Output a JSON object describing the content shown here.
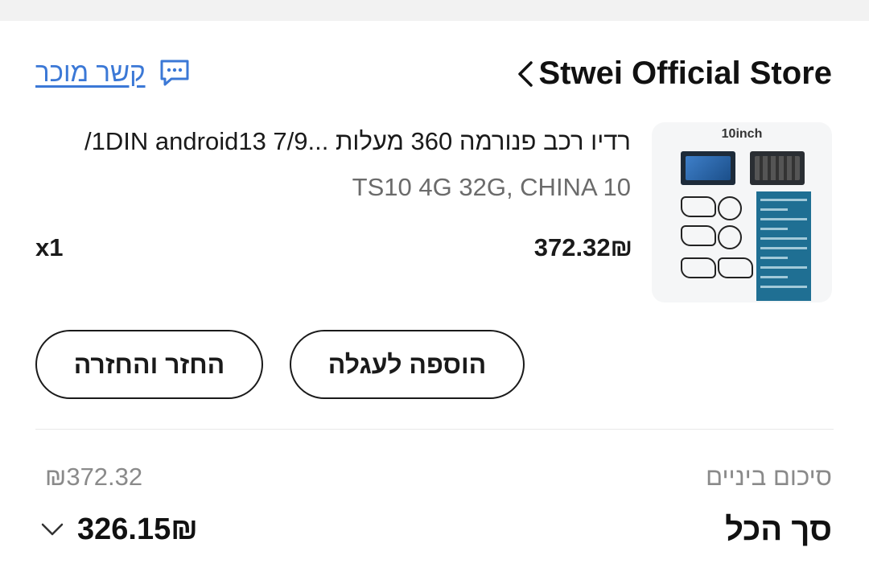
{
  "store": {
    "name": "Stwei Official Store",
    "contact_label": "קשר מוכר"
  },
  "product": {
    "thumbnail_caption": "10inch",
    "title": "רדיו רכב פנורמה 360 מעלות ...1DIN android13 7/9/",
    "variant": "TS10 4G 32G, CHINA 10",
    "price": "372.32₪",
    "quantity": "x1"
  },
  "actions": {
    "add_to_cart_label": "הוספה לעגלה",
    "return_label": "החזר והחזרה"
  },
  "summary": {
    "subtotal_label": "סיכום ביניים",
    "subtotal_value": "₪372.32",
    "total_label": "סך הכל",
    "total_value": "326.15₪"
  },
  "colors": {
    "link": "#3b78d6",
    "text": "#1a1a1a",
    "muted": "#8a8a8a",
    "background": "#ffffff"
  },
  "icons": {
    "back": "chevron-left-icon",
    "contact": "chat-bubble-icon",
    "expand": "chevron-down-icon"
  }
}
